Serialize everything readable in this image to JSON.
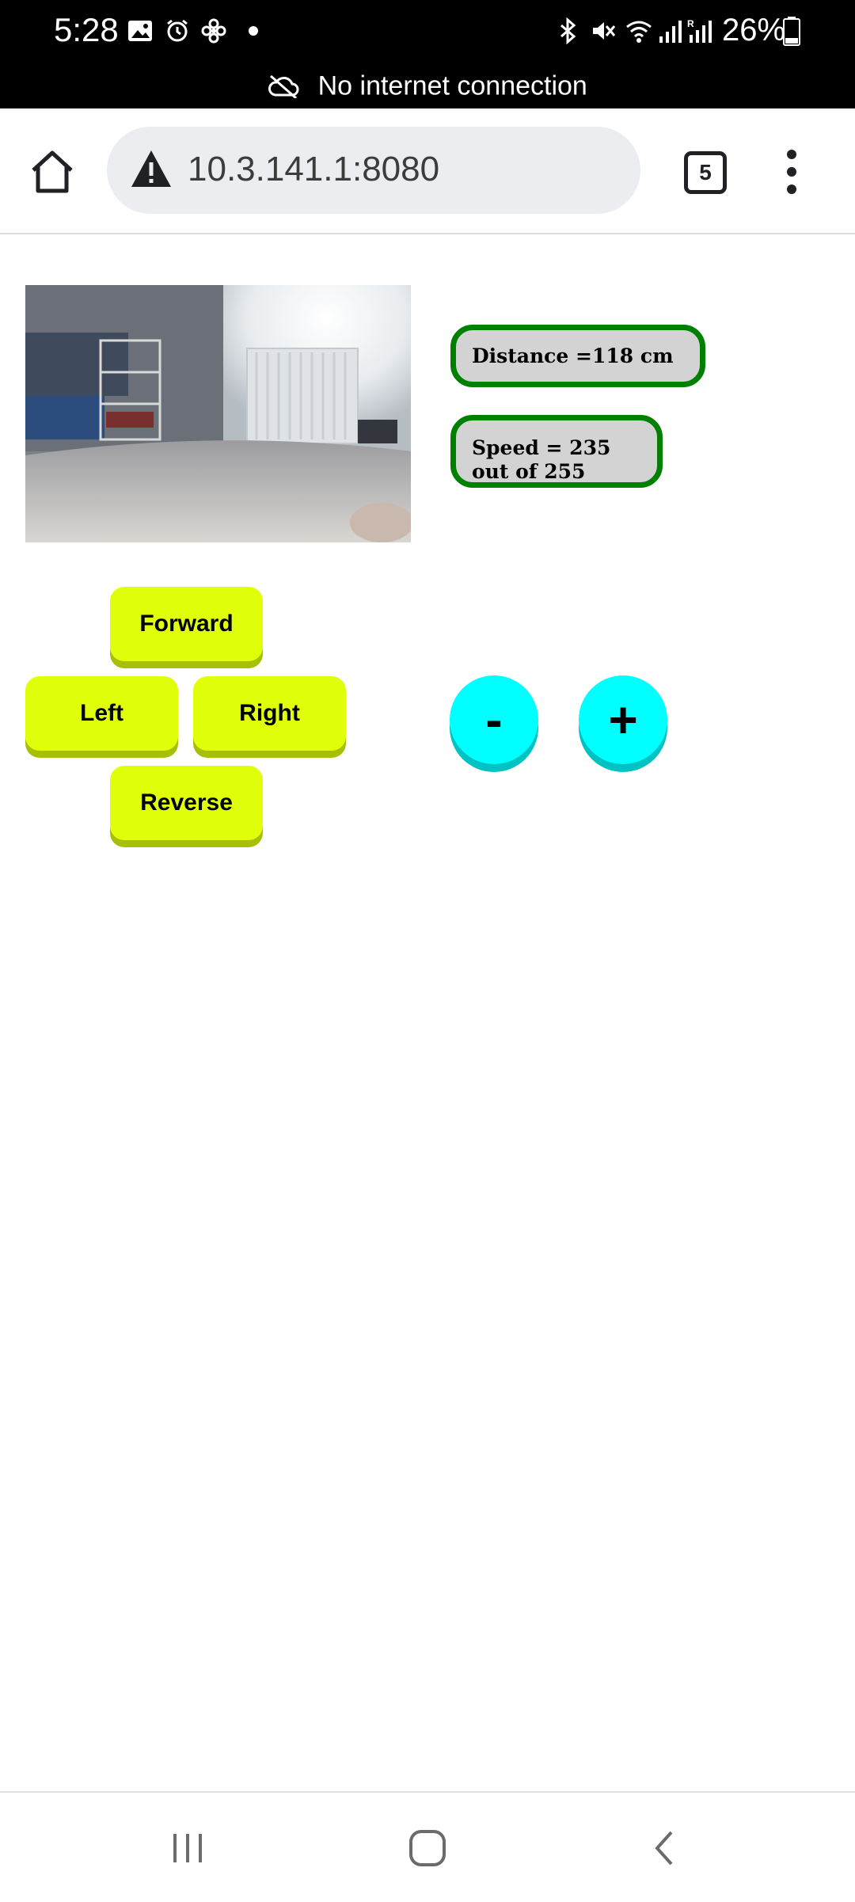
{
  "status_bar": {
    "time": "5:28",
    "battery": "26%",
    "network_message": "No internet connection",
    "icons": [
      "gallery-icon",
      "alarm-icon",
      "fan-icon",
      "dot-icon",
      "bluetooth-icon",
      "mute-icon",
      "wifi-icon",
      "signal-icon",
      "roaming-signal-icon",
      "battery-icon"
    ]
  },
  "browser": {
    "url": "10.3.141.1:8080",
    "tab_count": "5",
    "icons": [
      "home-icon",
      "warning-icon",
      "menu-icon"
    ]
  },
  "page": {
    "camera_feed": "camera-feed-image",
    "distance": "Distance =118 cm",
    "speed": "Speed = 235 out of 255",
    "controls": {
      "forward": "Forward",
      "left": "Left",
      "right": "Right",
      "reverse": "Reverse",
      "speed_down": "-",
      "speed_up": "+"
    }
  },
  "colors": {
    "direction_button": "#e0ff0b",
    "speed_button": "#00ffff",
    "info_border": "#008000",
    "info_background": "#d3d3d3"
  },
  "nav_bar": {
    "icons": [
      "recents-icon",
      "home-nav-icon",
      "back-icon"
    ]
  }
}
